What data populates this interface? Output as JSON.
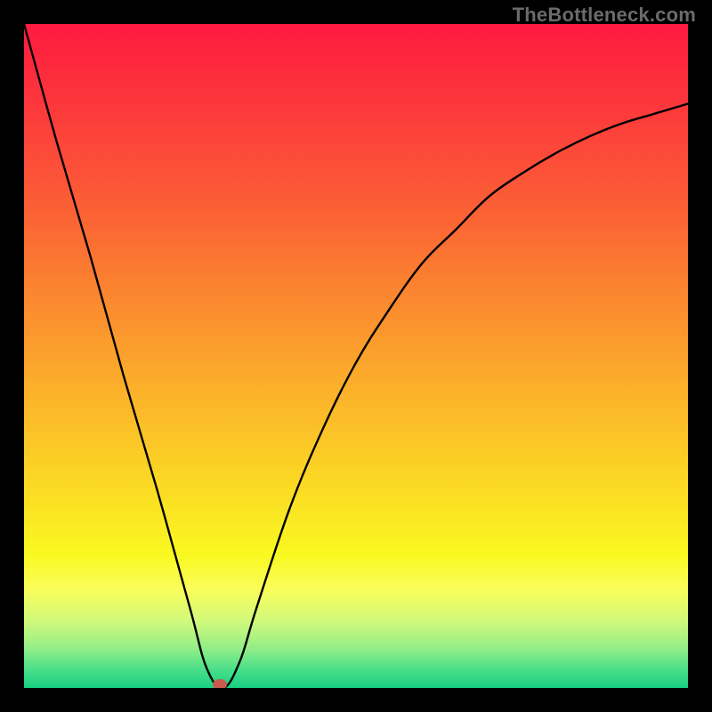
{
  "watermark": "TheBottleneck.com",
  "chart_data": {
    "type": "line",
    "title": "",
    "xlabel": "",
    "ylabel": "",
    "xlim": [
      0,
      100
    ],
    "ylim": [
      0,
      100
    ],
    "series": [
      {
        "name": "curve",
        "x": [
          0,
          5,
          10,
          15,
          20,
          25,
          27.5,
          30,
          32.5,
          35,
          40,
          45,
          50,
          55,
          60,
          65,
          70,
          75,
          80,
          85,
          90,
          95,
          100
        ],
        "y": [
          100,
          82,
          65,
          47,
          30,
          12,
          3,
          0,
          4,
          12,
          27,
          39,
          49,
          57,
          64,
          69,
          74,
          77.5,
          80.5,
          83,
          85,
          86.5,
          88
        ]
      }
    ],
    "marker": {
      "x": 29.5,
      "y": 0,
      "color": "#c95a4e"
    },
    "background_gradient": {
      "stops": [
        {
          "offset": 0.0,
          "color": "#fd1a40"
        },
        {
          "offset": 0.14,
          "color": "#fc3c3b"
        },
        {
          "offset": 0.28,
          "color": "#fb6035"
        },
        {
          "offset": 0.42,
          "color": "#fb8a2f"
        },
        {
          "offset": 0.56,
          "color": "#fbb32a"
        },
        {
          "offset": 0.7,
          "color": "#fbdb24"
        },
        {
          "offset": 0.8,
          "color": "#f9f920"
        },
        {
          "offset": 0.85,
          "color": "#fbfd59"
        },
        {
          "offset": 0.9,
          "color": "#d0f97c"
        },
        {
          "offset": 0.94,
          "color": "#93ee86"
        },
        {
          "offset": 0.97,
          "color": "#4ee08a"
        },
        {
          "offset": 1.0,
          "color": "#17cf82"
        }
      ]
    }
  }
}
